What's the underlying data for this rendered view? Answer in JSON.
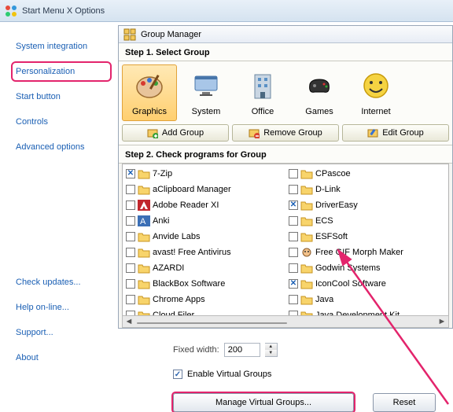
{
  "window_title": "Start Menu X Options",
  "sidebar": {
    "items": [
      {
        "label": "System integration"
      },
      {
        "label": "Personalization"
      },
      {
        "label": "Start button"
      },
      {
        "label": "Controls"
      },
      {
        "label": "Advanced options"
      }
    ],
    "bottom": [
      {
        "label": "Check updates..."
      },
      {
        "label": "Help on-line..."
      },
      {
        "label": "Support..."
      },
      {
        "label": "About"
      }
    ],
    "active_index": 1
  },
  "group_manager": {
    "title": "Group Manager",
    "step1": "Step 1. Select Group",
    "step2": "Step 2. Check programs for Group",
    "groups": [
      {
        "label": "Graphics"
      },
      {
        "label": "System"
      },
      {
        "label": "Office"
      },
      {
        "label": "Games"
      },
      {
        "label": "Internet"
      }
    ],
    "selected_group": 0,
    "toolbar": {
      "add": "Add Group",
      "remove": "Remove Group",
      "edit": "Edit Group"
    },
    "programs_col1": [
      {
        "checked": true,
        "name": "7-Zip",
        "icon": "folder"
      },
      {
        "checked": false,
        "name": "aClipboard Manager",
        "icon": "folder"
      },
      {
        "checked": false,
        "name": "Adobe Reader XI",
        "icon": "adobe"
      },
      {
        "checked": false,
        "name": "Anki",
        "icon": "anki"
      },
      {
        "checked": false,
        "name": "Anvide Labs",
        "icon": "folder"
      },
      {
        "checked": false,
        "name": "avast! Free Antivirus",
        "icon": "folder"
      },
      {
        "checked": false,
        "name": "AZARDI",
        "icon": "folder"
      },
      {
        "checked": false,
        "name": "BlackBox Software",
        "icon": "folder"
      },
      {
        "checked": false,
        "name": "Chrome Apps",
        "icon": "folder"
      },
      {
        "checked": false,
        "name": "Cloud Filer",
        "icon": "folder"
      }
    ],
    "programs_col2": [
      {
        "checked": false,
        "name": "CPascoe",
        "icon": "folder"
      },
      {
        "checked": false,
        "name": "D-Link",
        "icon": "folder"
      },
      {
        "checked": true,
        "name": "DriverEasy",
        "icon": "folder"
      },
      {
        "checked": false,
        "name": "ECS",
        "icon": "folder"
      },
      {
        "checked": false,
        "name": "ESFSoft",
        "icon": "folder"
      },
      {
        "checked": false,
        "name": "Free GIF Morph Maker",
        "icon": "gif"
      },
      {
        "checked": false,
        "name": "Godwin Systems",
        "icon": "folder"
      },
      {
        "checked": true,
        "name": "IconCool Software",
        "icon": "folder"
      },
      {
        "checked": false,
        "name": "Java",
        "icon": "folder"
      },
      {
        "checked": false,
        "name": "Java Development Kit",
        "icon": "folder"
      }
    ]
  },
  "fixed_width": {
    "label": "Fixed width:",
    "value": "200"
  },
  "enable_vg": "Enable Virtual Groups",
  "manage_btn": "Manage Virtual Groups...",
  "reset_btn": "Reset"
}
